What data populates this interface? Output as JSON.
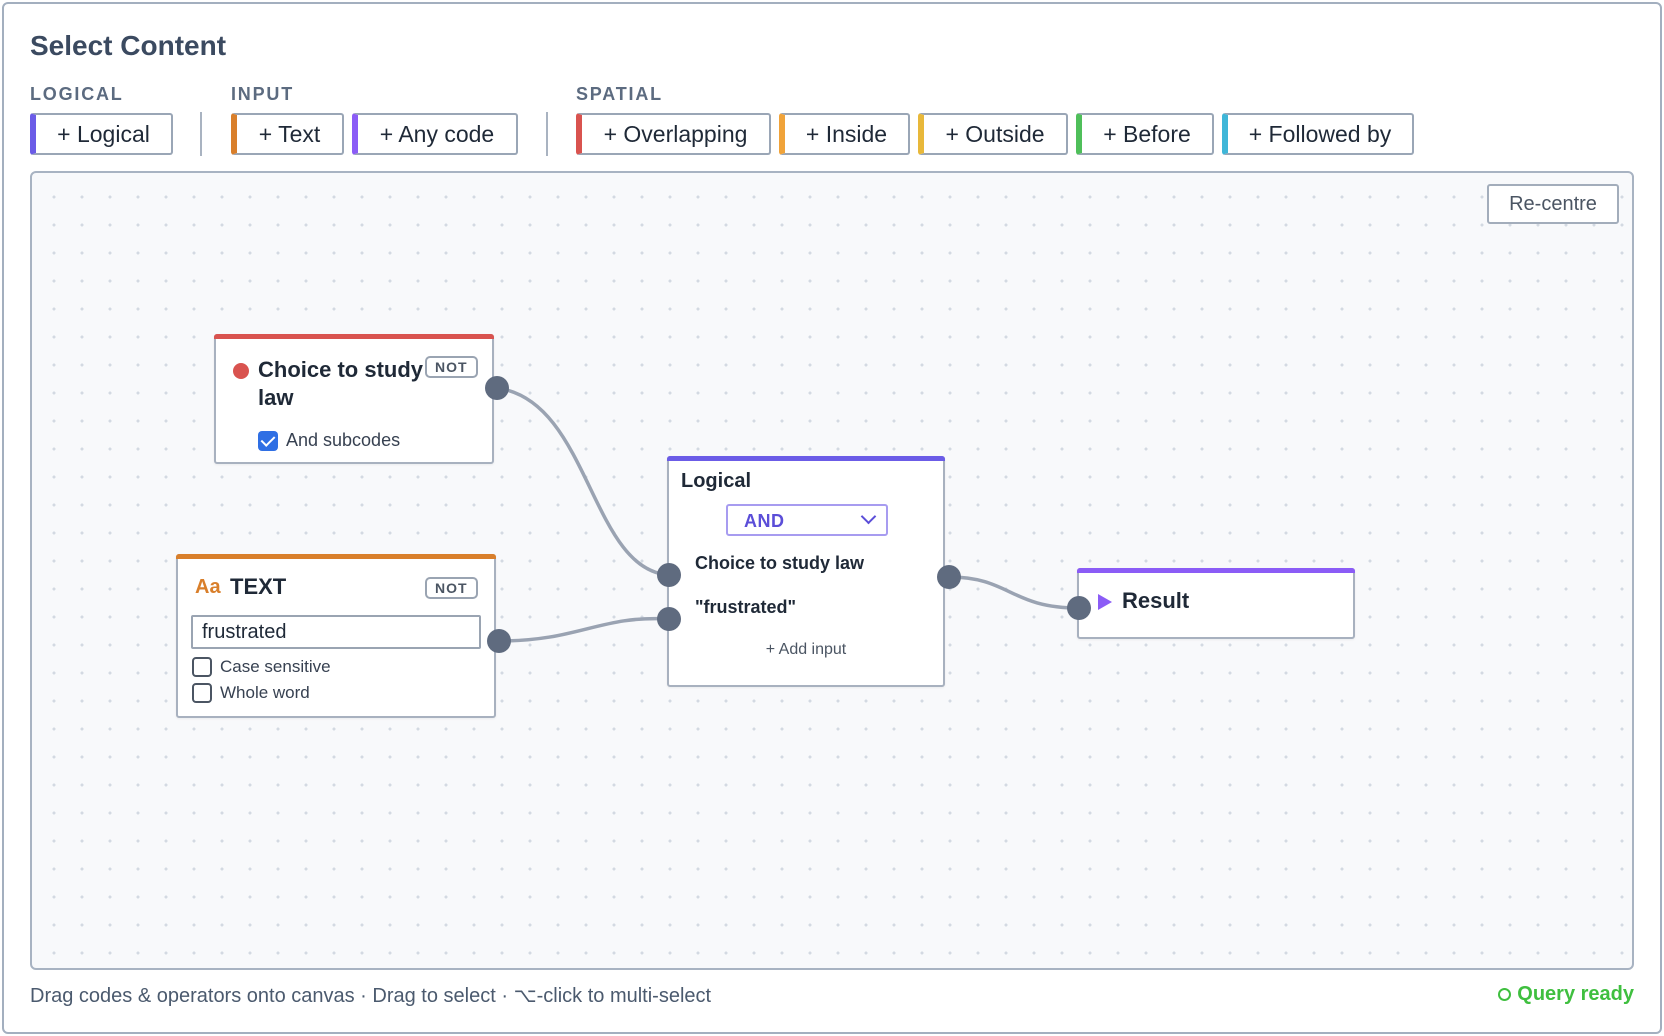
{
  "header": {
    "title": "Select Content"
  },
  "toolbar": {
    "groups": [
      {
        "label": "LOGICAL"
      },
      {
        "label": "INPUT"
      },
      {
        "label": "SPATIAL"
      }
    ],
    "buttons": [
      {
        "label": "+ Logical",
        "accent": "#6b5ce7"
      },
      {
        "label": "+ Text",
        "accent": "#d97f2b"
      },
      {
        "label": "+ Any code",
        "accent": "#8b5cf6"
      },
      {
        "label": "+ Overlapping",
        "accent": "#d9534f"
      },
      {
        "label": "+ Inside",
        "accent": "#f0a33a"
      },
      {
        "label": "+ Outside",
        "accent": "#e8b83a"
      },
      {
        "label": "+ Before",
        "accent": "#4fbf5a"
      },
      {
        "label": "+ Followed by",
        "accent": "#3fb6d8"
      }
    ]
  },
  "canvas": {
    "recentre_label": "Re-centre",
    "code_node": {
      "title": "Choice to study law",
      "badge": "NOT",
      "dot_color": "#d9534f",
      "subcodes_label": "And subcodes",
      "subcodes_checked": true,
      "accent": "#d9534f"
    },
    "text_node": {
      "icon": "Aa",
      "title": "TEXT",
      "badge": "NOT",
      "value": "frustrated",
      "case_sensitive_label": "Case sensitive",
      "case_sensitive_checked": false,
      "whole_word_label": "Whole word",
      "whole_word_checked": false,
      "accent": "#d97f2b"
    },
    "logical_node": {
      "title": "Logical",
      "operator": "AND",
      "inputs": [
        "Choice to study law",
        "\"frustrated\""
      ],
      "add_input_label": "+ Add input",
      "accent": "#6b5ce7"
    },
    "result_node": {
      "title": "Result",
      "accent": "#8b5cf6"
    }
  },
  "footer": {
    "hint": "Drag codes & operators onto canvas · Drag to select · ⌥-click to multi-select",
    "status": "Query ready",
    "status_color": "#3fbf3f"
  }
}
